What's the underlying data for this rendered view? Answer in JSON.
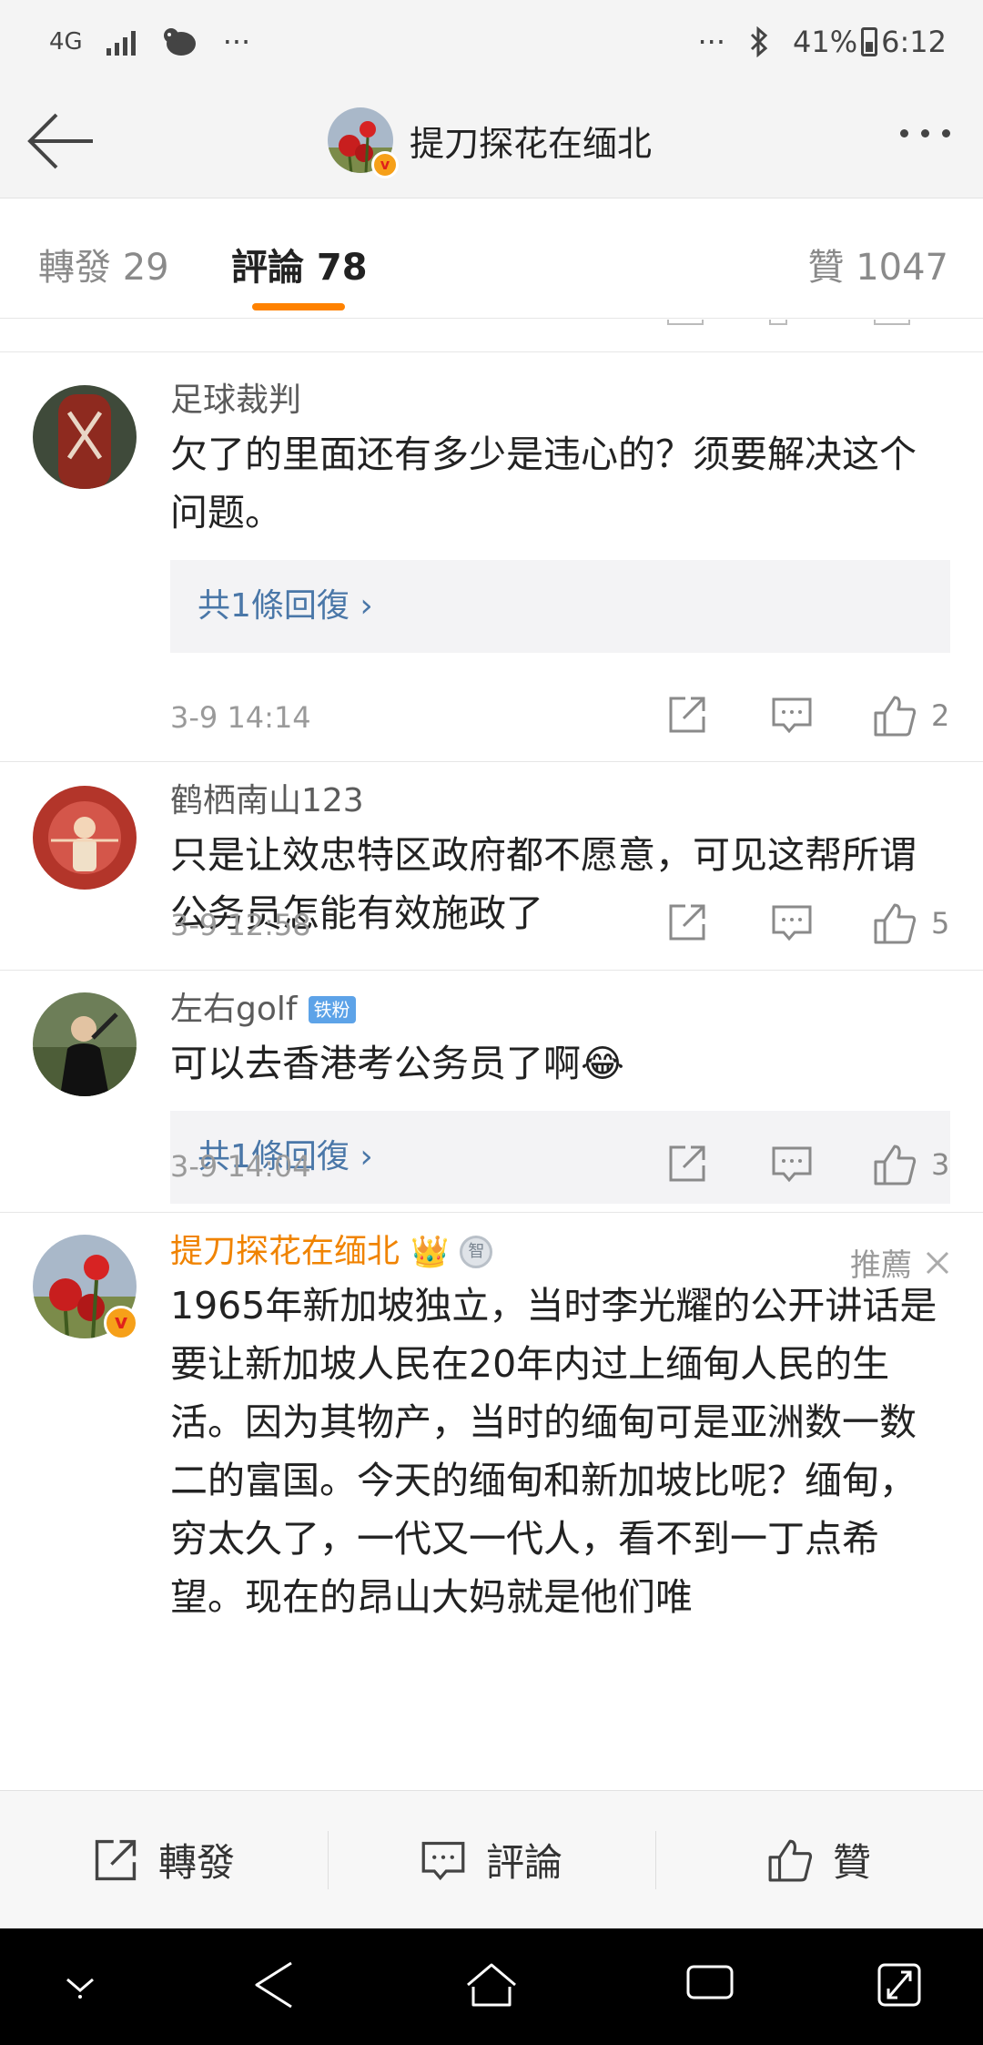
{
  "status_bar": {
    "network": "4G",
    "left_dots": "···",
    "right_dots": "···",
    "battery_percent": "41%",
    "time": "6:12"
  },
  "header": {
    "title": "提刀探花在缅北"
  },
  "tabs": {
    "repost": "轉發 29",
    "comment": "評論 78",
    "like": "贊 1047"
  },
  "comments": [
    {
      "username": "足球裁判",
      "text": "欠了的里面还有多少是违心的？须要解决这个问题。",
      "reply_label": "共1條回復 ›",
      "time": "3-9 14:14",
      "likes": "2"
    },
    {
      "username": "鹤栖南山123",
      "text": "只是让效忠特区政府都不愿意，可见这帮所谓公务员怎能有效施政了",
      "time": "3-9 12:58",
      "likes": "5"
    },
    {
      "username": "左右golf",
      "badge": "铁粉",
      "text": "可以去香港考公务员了啊😂",
      "reply_label": "共1條回復 ›",
      "time": "3-9 14:04",
      "likes": "3"
    },
    {
      "username": "提刀探花在缅北",
      "medal": "智",
      "recommend": "推薦",
      "text": "1965年新加坡独立，当时李光耀的公开讲话是要让新加坡人民在20年内过上缅甸人民的生活。因为其物产，当时的缅甸可是亚洲数一数二的富国。今天的缅甸和新加坡比呢？缅甸，穷太久了，一代又一代人，看不到一丁点希望。现在的昂山大妈就是他们唯"
    }
  ],
  "bottom_bar": {
    "repost": "轉發",
    "comment": "評論",
    "like": "贊"
  },
  "icons": {
    "back": "arrow-left-icon",
    "more": "more-dots-icon",
    "forward": "share-box-icon",
    "comment": "comment-bubble-icon",
    "like": "thumbs-up-icon"
  },
  "colors": {
    "accent": "#ff8200",
    "link": "#4a77a8",
    "author_name": "#f08300",
    "verified_badge": "#f6a019"
  }
}
